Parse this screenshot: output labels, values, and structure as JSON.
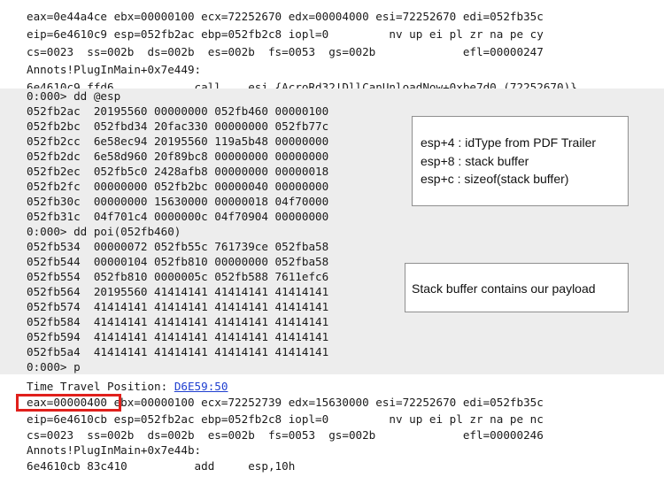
{
  "console": {
    "lines": [
      "eax=0e44a4ce ebx=00000100 ecx=72252670 edx=00004000 esi=72252670 edi=052fb35c",
      "eip=6e4610c9 esp=052fb2ac ebp=052fb2c8 iopl=0         nv up ei pl zr na pe cy",
      "cs=0023  ss=002b  ds=002b  es=002b  fs=0053  gs=002b             efl=00000247",
      "Annots!PlugInMain+0x7e449:",
      "6e4610c9 ffd6            call    esi {AcroRd32!DllCanUnloadNow+0xbe7d0 (72252670)}",
      "0:000> dd @esp",
      "052fb2ac  20195560 00000000 052fb460 00000100",
      "052fb2bc  052fbd34 20fac330 00000000 052fb77c",
      "052fb2cc  6e58ec94 20195560 119a5b48 00000000",
      "052fb2dc  6e58d960 20f89bc8 00000000 00000000",
      "052fb2ec  052fb5c0 2428afb8 00000000 00000018",
      "052fb2fc  00000000 052fb2bc 00000040 00000000",
      "052fb30c  00000000 15630000 00000018 04f70000",
      "052fb31c  04f701c4 0000000c 04f70904 00000000",
      "0:000> dd poi(052fb460)",
      "052fb534  00000072 052fb55c 761739ce 052fba58",
      "052fb544  00000104 052fb810 00000000 052fba58",
      "052fb554  052fb810 0000005c 052fb588 7611efc6",
      "052fb564  20195560 41414141 41414141 41414141",
      "052fb574  41414141 41414141 41414141 41414141",
      "052fb584  41414141 41414141 41414141 41414141",
      "052fb594  41414141 41414141 41414141 41414141",
      "052fb5a4  41414141 41414141 41414141 41414141",
      "0:000> p",
      "Time Travel Position: ",
      "eax=00000400 ebx=00000100 ecx=72252739 edx=15630000 esi=72252670 edi=052fb35c",
      "eip=6e4610cb esp=052fb2ac ebp=052fb2c8 iopl=0         nv up ei pl zr na pe nc",
      "cs=0023  ss=002b  ds=002b  es=002b  fs=0053  gs=002b             efl=00000246",
      "Annots!PlugInMain+0x7e44b:",
      "6e4610cb 83c410          add     esp,10h"
    ],
    "time_travel_link": "D6E59:50"
  },
  "notes": {
    "stack_args": [
      "esp+4 : idType from PDF Trailer",
      "esp+8 : stack buffer",
      "esp+c : sizeof(stack buffer)"
    ],
    "payload": "Stack buffer contains our payload"
  },
  "colors": {
    "highlight": "#ededed",
    "link": "#1f3fd0",
    "callout_border": "#e0201c"
  }
}
